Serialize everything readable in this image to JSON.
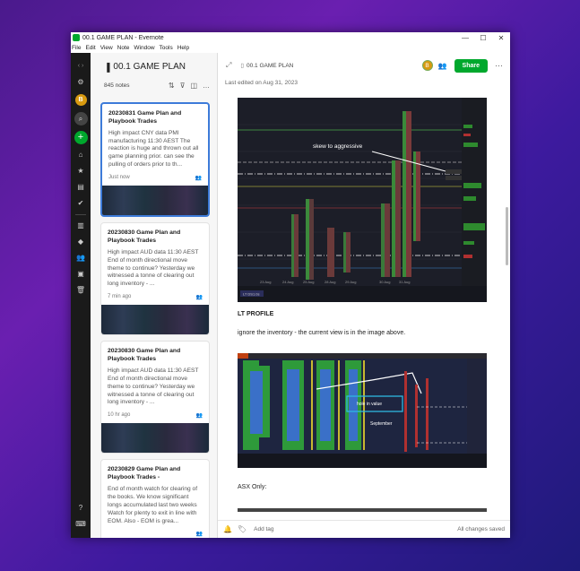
{
  "window": {
    "title": "00.1 GAME PLAN - Evernote",
    "controls": [
      "—",
      "☐",
      "✕"
    ]
  },
  "menu": [
    "File",
    "Edit",
    "View",
    "Note",
    "Window",
    "Tools",
    "Help"
  ],
  "nav": {
    "avatar_letter": "B",
    "colors": {
      "accent": "#00a82d",
      "avatar": "#d89a10"
    }
  },
  "notebook": {
    "title": "00.1 GAME PLAN",
    "count": "845 notes"
  },
  "notes": [
    {
      "title": "20230831 Game Plan and Playbook Trades",
      "snippet": "High impact CNY data PMI manufacturing 11:30 AEST The reaction is huge and thrown out all game planning prior. can see the pulling of orders prior to th...",
      "time": "Just now",
      "selected": true
    },
    {
      "title": "20230830 Game Plan and Playbook Trades",
      "snippet": "High impact AUD data 11:30 AEST End of month directional move theme to continue? Yesterday we witnessed a tonne of clearing out long inventory - ...",
      "time": "7 min ago",
      "selected": false
    },
    {
      "title": "20230830 Game Plan and Playbook Trades",
      "snippet": "High impact AUD data 11:30 AEST End of month directional move theme to continue? Yesterday we witnessed a tonne of clearing out long inventory - ...",
      "time": "10 hr ago",
      "selected": false
    },
    {
      "title": "20230829 Game Plan and Playbook Trades -",
      "snippet": "End of month watch for clearing of the books. We know significant longs accumulated last two weeks Watch for plenty to exit in line with EOM. Also - EOM is grea...",
      "time": "",
      "selected": false
    }
  ],
  "editor": {
    "breadcrumb": "00.1 GAME PLAN",
    "badge_letter": "B",
    "share_label": "Share",
    "last_edited": "Last edited on Aug 31, 2023",
    "chart1_annotation": "skew to aggressive",
    "chart1_dates": [
      "23 Aug",
      "24 Aug",
      "25 Aug",
      "28 Aug",
      "29 Aug",
      "30 Aug",
      "31 Aug"
    ],
    "chart1_tag": "LT DS1.0s",
    "heading_lt_profile": "LT PROFILE",
    "para_inventory": "ignore the inventory  - the current view is in the image above.",
    "chart2_annotation_hole": "hole in value",
    "chart2_annotation_sep": "September",
    "heading_asx": "ASX Only:",
    "add_tag": "Add tag",
    "save_status": "All changes saved"
  }
}
